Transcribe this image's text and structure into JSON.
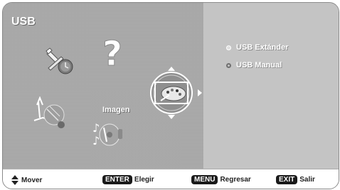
{
  "title": "USB",
  "center_label": "Imagen",
  "icons": {
    "question": "question-mark",
    "tools": "tools-icon",
    "antenna": "antenna-icon",
    "palette": "palette-icon",
    "music": "music-icon"
  },
  "menu": {
    "items": [
      {
        "label": "USB Extánder",
        "state": "selected"
      },
      {
        "label": "USB Manual",
        "state": "unselected"
      }
    ]
  },
  "footer": {
    "move_icon": "up-down-arrows",
    "move_label": "Mover",
    "enter_key": "ENTER",
    "enter_label": "Elegir",
    "menu_key": "MENU",
    "menu_label": "Regresar",
    "exit_key": "EXIT",
    "exit_label": "Salir"
  },
  "colors": {
    "left_panel": "#a8a8a8",
    "right_panel": "#c9c9c9",
    "footer": "#ffffff"
  }
}
